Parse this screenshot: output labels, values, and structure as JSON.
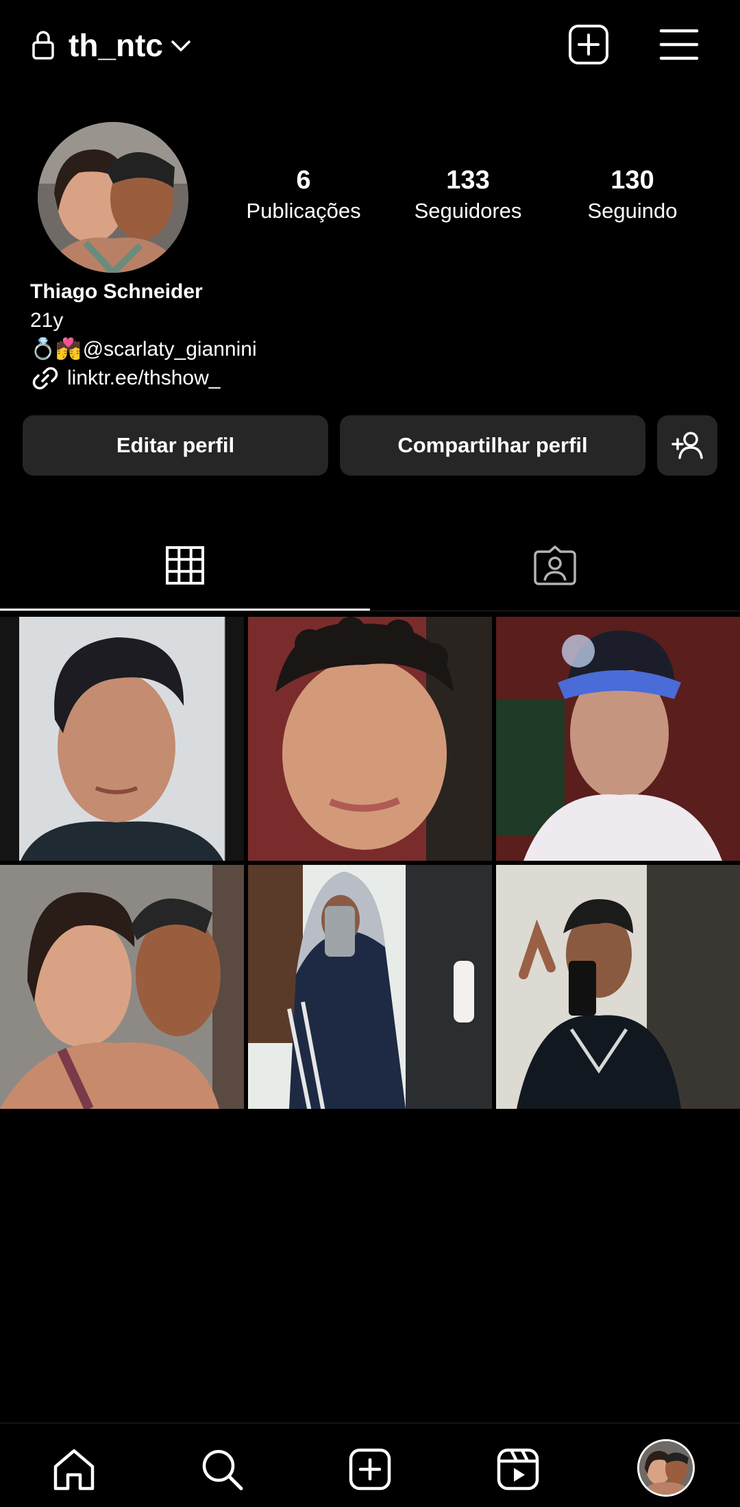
{
  "header": {
    "username": "th_ntc",
    "icons": {
      "lock": "lock-icon",
      "chevron": "chevron-down-icon",
      "new_post": "add-square-icon",
      "menu": "hamburger-menu-icon"
    }
  },
  "profile": {
    "stats": [
      {
        "value": "6",
        "label": "Publicações"
      },
      {
        "value": "133",
        "label": "Seguidores"
      },
      {
        "value": "130",
        "label": "Seguindo"
      }
    ],
    "name": "Thiago Schneider",
    "age": "21y",
    "mention_prefix": "💍💏",
    "mention": "@scarlaty_giannini",
    "link": "linktr.ee/thshow_"
  },
  "actions": {
    "edit": "Editar perfil",
    "share": "Compartilhar perfil",
    "add_user_icon": "add-person-icon"
  },
  "tabs": [
    {
      "name": "grid",
      "icon": "grid-icon",
      "active": true
    },
    {
      "name": "tagged",
      "icon": "tagged-person-icon",
      "active": false
    }
  ],
  "grid": {
    "post_count": 6
  },
  "bottom_nav": {
    "items": [
      "home-icon",
      "search-icon",
      "create-icon",
      "reels-icon",
      "profile-avatar"
    ]
  },
  "colors": {
    "background": "#000000",
    "button": "#262626",
    "text": "#ffffff"
  }
}
